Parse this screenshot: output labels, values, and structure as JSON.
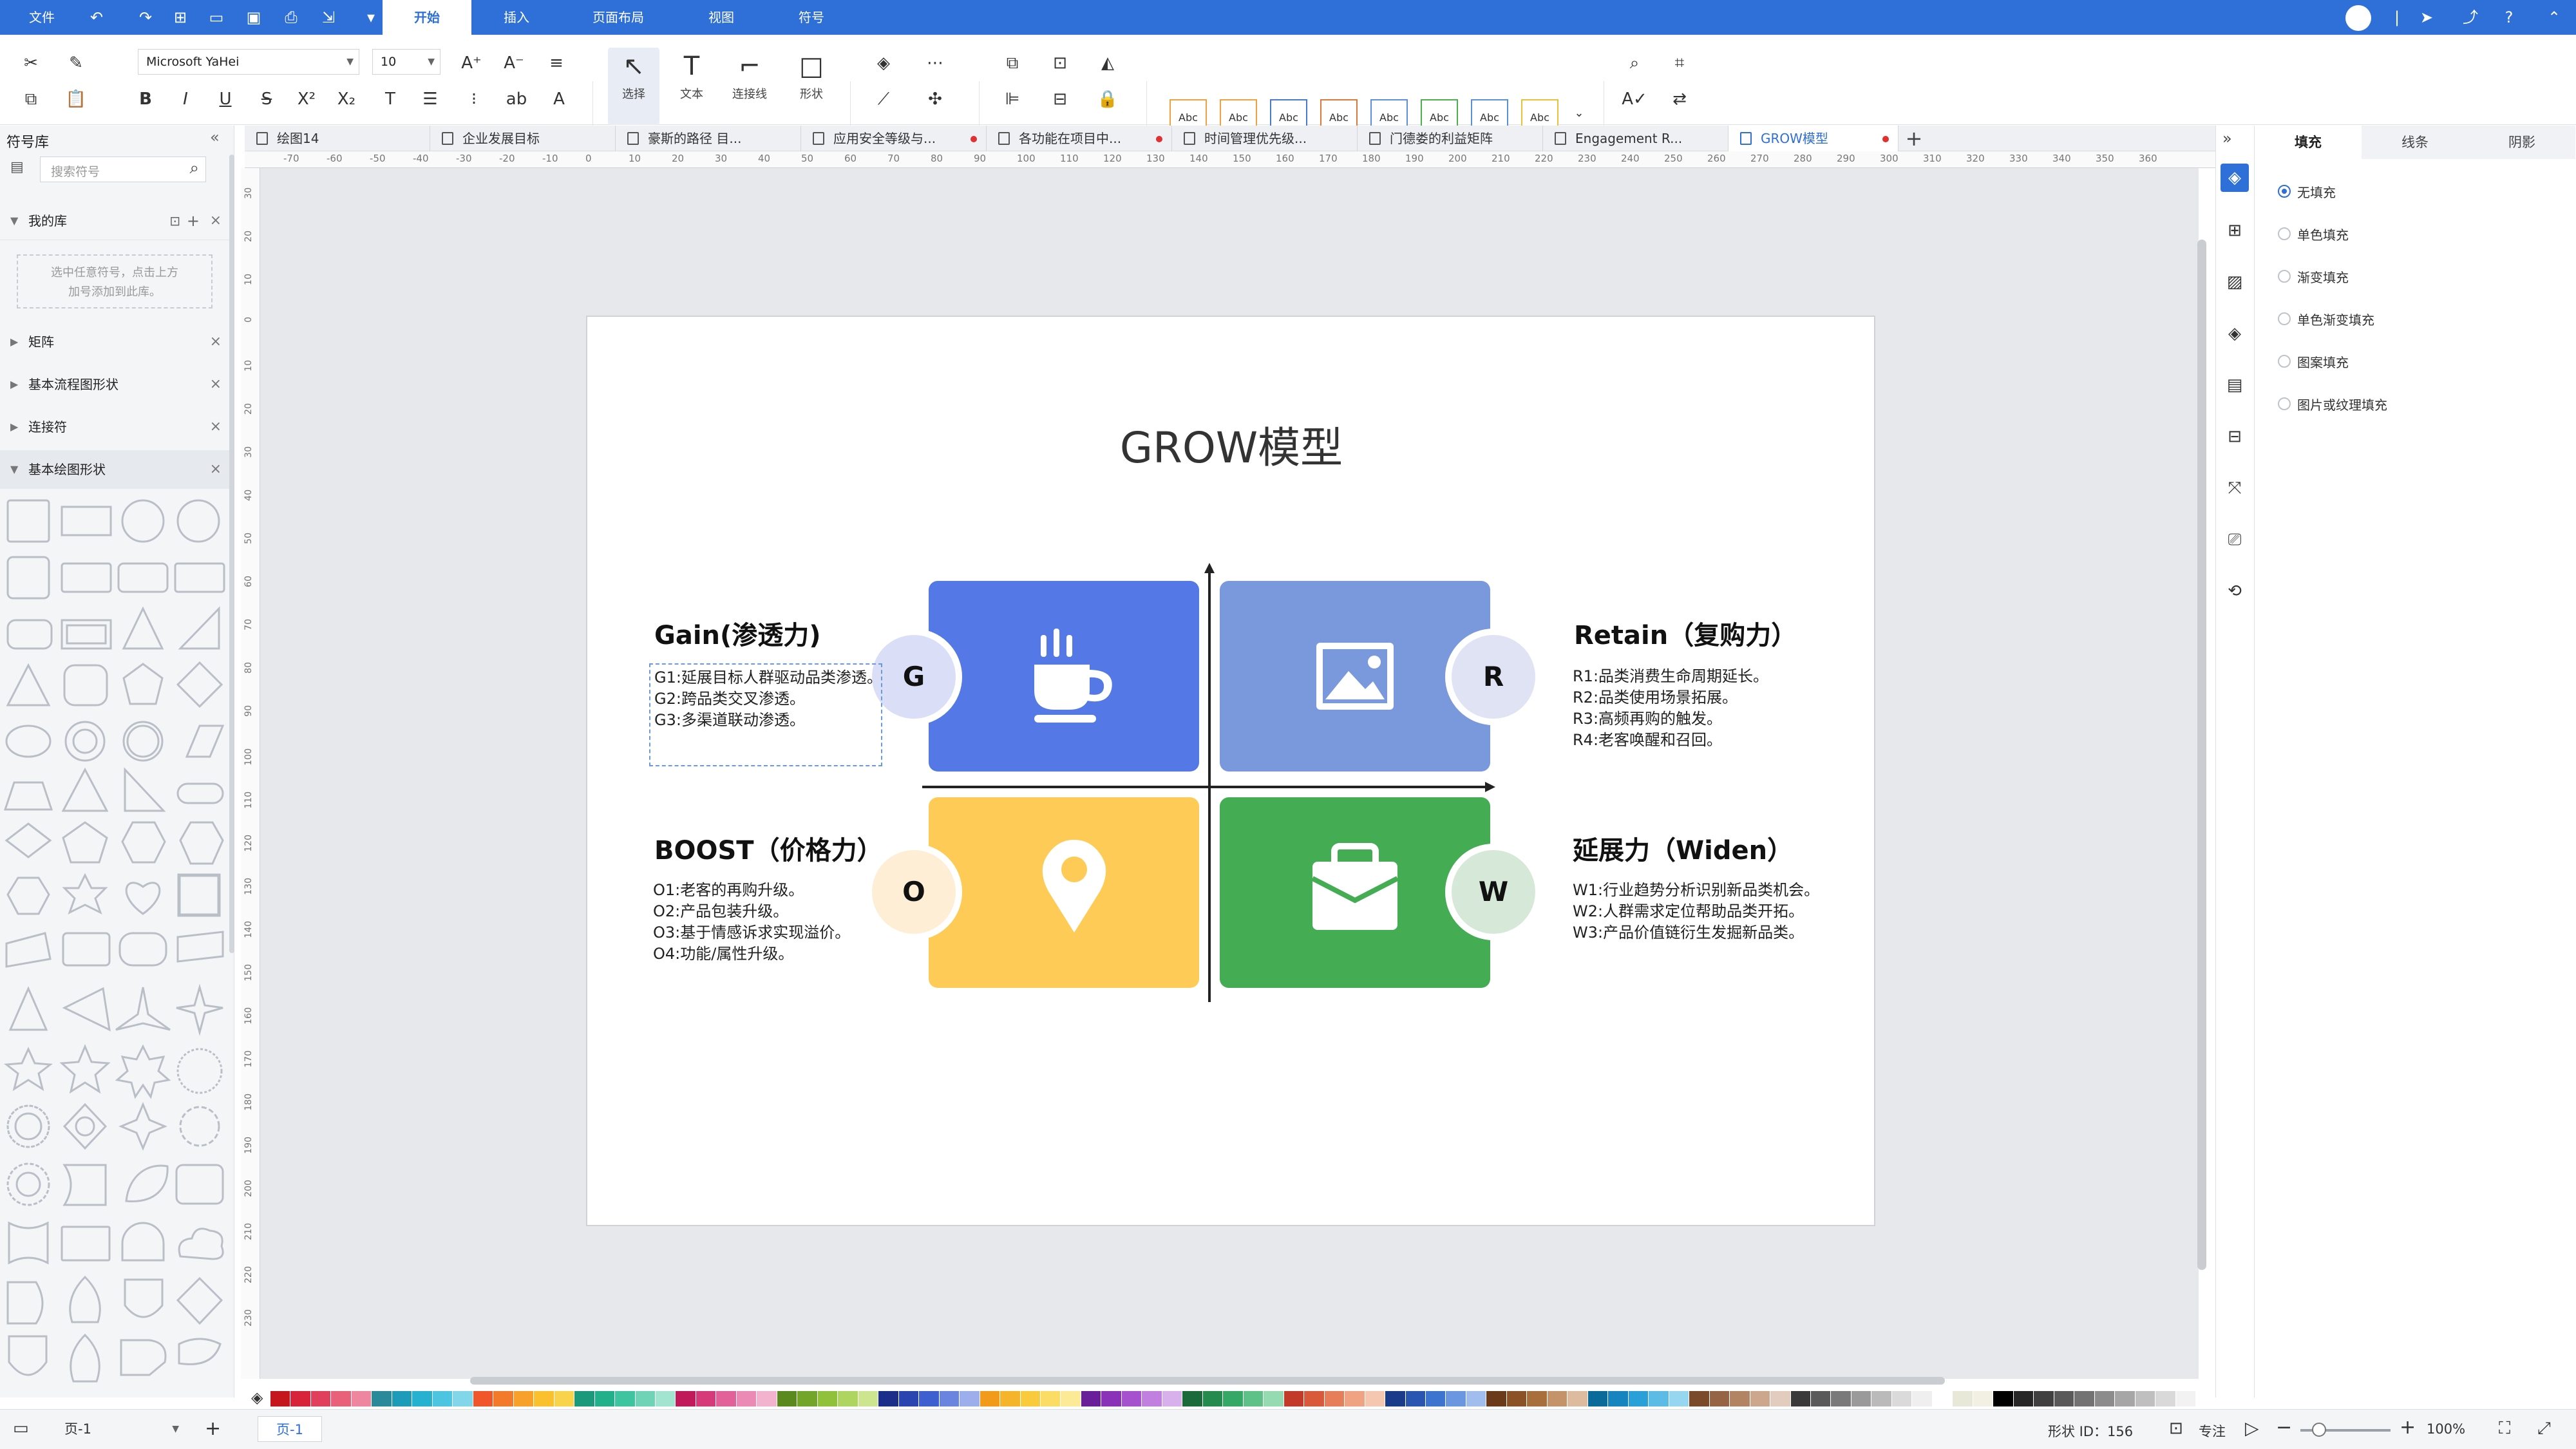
{
  "topbar": {
    "file_label": "文件",
    "tabs": [
      "开始",
      "插入",
      "页面布局",
      "视图",
      "符号"
    ]
  },
  "ribbon": {
    "font_name": "Microsoft YaHei",
    "font_size": "10",
    "select_label": "选择",
    "text_label": "文本",
    "connector_label": "连接线",
    "shape_label": "形状",
    "style_swatch_label": "Abc",
    "style_swatch_colors": [
      "#f0a23c",
      "#f0a23c",
      "#4a78d6",
      "#e0783a",
      "#5b8de0",
      "#4caf50",
      "#5b8de0",
      "#e6c23a"
    ]
  },
  "left_panel": {
    "title": "符号库",
    "search_placeholder": "搜索符号",
    "my_library": "我的库",
    "empty_hint_1": "选中任意符号，点击上方",
    "empty_hint_2": "加号添加到此库。",
    "sections": [
      "矩阵",
      "基本流程图形状",
      "连接符",
      "基本绘图形状"
    ]
  },
  "doc_tabs": [
    {
      "label": "绘图14",
      "dot": false
    },
    {
      "label": "企业发展目标",
      "dot": false
    },
    {
      "label": "豪斯的路径 目...",
      "dot": false
    },
    {
      "label": "应用安全等级与...",
      "dot": true
    },
    {
      "label": "各功能在项目中...",
      "dot": true
    },
    {
      "label": "时间管理优先级...",
      "dot": false
    },
    {
      "label": "门德娄的利益矩阵",
      "dot": false
    },
    {
      "label": "Engagement R...",
      "dot": false
    },
    {
      "label": "GROW模型",
      "dot": true
    }
  ],
  "ruler": {
    "h_ticks": [
      "-70",
      "-60",
      "-50",
      "-40",
      "-30",
      "-20",
      "-10",
      "0",
      "10",
      "20",
      "30",
      "40",
      "50",
      "60",
      "70",
      "80",
      "90",
      "100",
      "110",
      "120",
      "130",
      "140",
      "150",
      "160",
      "170",
      "180",
      "190",
      "200",
      "210",
      "220",
      "230",
      "240",
      "250",
      "260",
      "270",
      "280",
      "290",
      "300",
      "310",
      "320",
      "330",
      "340",
      "350",
      "360"
    ],
    "v_ticks": [
      "30",
      "20",
      "10",
      "0",
      "10",
      "20",
      "30",
      "40",
      "50",
      "60",
      "70",
      "80",
      "90",
      "100",
      "110",
      "120",
      "130",
      "140",
      "150",
      "160",
      "170",
      "180",
      "190",
      "200",
      "210",
      "220",
      "230"
    ]
  },
  "diagram": {
    "title": "GROW模型",
    "quadrants": [
      {
        "key": "G",
        "letter": "G",
        "color": "#5479e6",
        "icon": "coffee-cup-icon",
        "title": "Gain(渗透力)",
        "lines": [
          "G1:延展目标人群驱动品类渗透。",
          "G2:跨品类交叉渗透。",
          "G3:多渠道联动渗透。"
        ]
      },
      {
        "key": "R",
        "letter": "R",
        "color": "#7a98dc",
        "icon": "image-icon",
        "title": "Retain（复购力）",
        "lines": [
          "R1:品类消费生命周期延长。",
          "R2:品类使用场景拓展。",
          "R3:高频再购的触发。",
          "R4:老客唤醒和召回。"
        ]
      },
      {
        "key": "O",
        "letter": "O",
        "color": "#fecc56",
        "icon": "location-pin-icon",
        "title": "BOOST（价格力）",
        "lines": [
          "O1:老客的再购升级。",
          "O2:产品包装升级。",
          "O3:基于情感诉求实现溢价。",
          "O4:功能/属性升级。"
        ]
      },
      {
        "key": "W",
        "letter": "W",
        "color": "#44ad53",
        "icon": "briefcase-icon",
        "title": "延展力（Widen）",
        "lines": [
          "W1:行业趋势分析识别新品类机会。",
          "W2:人群需求定位帮助品类开拓。",
          "W3:产品价值链衍生发掘新品类。"
        ]
      }
    ],
    "circle_colors": {
      "G": "#dadff7",
      "R": "#dfe3f4",
      "O": "#fdeed5",
      "W": "#d6e8d8"
    }
  },
  "right_panel": {
    "tabs": [
      "填充",
      "线条",
      "阴影"
    ],
    "fill_options": [
      "无填充",
      "单色填充",
      "渐变填充",
      "单色渐变填充",
      "图案填充",
      "图片或纹理填充"
    ],
    "selected_option": "无填充"
  },
  "palette": [
    "#c4161c",
    "#d8243a",
    "#e0405c",
    "#e8607a",
    "#ef86a0",
    "#2a8a9a",
    "#1e9bb8",
    "#25b1cf",
    "#4dc4e0",
    "#82d6ea",
    "#f0562a",
    "#f37a2a",
    "#f7a12a",
    "#fbc02d",
    "#f9d34c",
    "#1a9a7a",
    "#22b08a",
    "#3ec49e",
    "#6fd3b5",
    "#a2e4cf",
    "#c01a5a",
    "#d63a78",
    "#e26198",
    "#ec8ab6",
    "#f3b3cf",
    "#5a8a1e",
    "#72a52a",
    "#8fc13a",
    "#aed55f",
    "#cce58e",
    "#1a2e8a",
    "#2a44b0",
    "#3e5fd0",
    "#6a85e0",
    "#9caeeb",
    "#f29a1a",
    "#f6b42a",
    "#f9ca3c",
    "#fbdd66",
    "#fcea97",
    "#6a1e9a",
    "#8a32b8",
    "#a652cf",
    "#c180df",
    "#d8b0ec",
    "#1a6a3a",
    "#258a4e",
    "#35a866",
    "#5ec288",
    "#95dab0",
    "#c23a2a",
    "#d95a3a",
    "#e67e5a",
    "#ef a383",
    "#f6c7b0",
    "#1a3a8a",
    "#2856b0",
    "#3d74d0",
    "#6b97e0",
    "#a0bdee",
    "#6a3a1a",
    "#8a5226",
    "#a86e3c",
    "#c5936a",
    "#ddbb9e",
    "#0a6a9a",
    "#1684bf",
    "#2aa0d8",
    "#5cbce5",
    "#96d6f0",
    "#7a4a2a",
    "#966444",
    "#b28464",
    "#cca78e",
    "#e2ccbd",
    "#3a3a3a",
    "#5a5a5a",
    "#7a7a7a",
    "#9a9a9a",
    "#bababa",
    "#dadada",
    "#efefef",
    "#ffffff",
    "#e8e8d8",
    "#f2f0e2",
    "#000000",
    "#262626",
    "#404040",
    "#595959",
    "#737373",
    "#8c8c8c",
    "#a6a6a6",
    "#bfbfbf",
    "#d9d9d9",
    "#f2f2f2"
  ],
  "status": {
    "page_selector": "页-1",
    "page_tab": "页-1",
    "shape_id": "形状 ID：156",
    "focus_label": "专注",
    "zoom": "100%"
  }
}
